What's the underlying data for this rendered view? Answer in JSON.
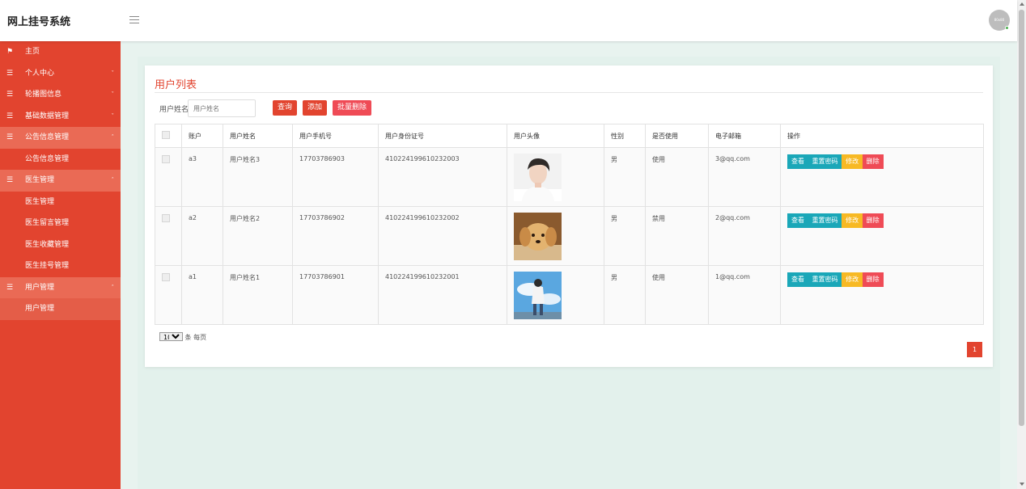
{
  "app": {
    "title": "网上挂号系统",
    "avatar_text": "80x80"
  },
  "sidebar": {
    "items": [
      {
        "label": "主页",
        "icon": "flag-icon",
        "caret": ""
      },
      {
        "label": "个人中心",
        "icon": "menu-icon",
        "caret": "ˇ"
      },
      {
        "label": "轮播图信息",
        "icon": "menu-icon",
        "caret": "ˇ"
      },
      {
        "label": "基础数据管理",
        "icon": "menu-icon",
        "caret": "ˇ"
      },
      {
        "label": "公告信息管理",
        "icon": "menu-icon",
        "caret": "ˆ"
      },
      {
        "label": "医生管理",
        "icon": "menu-icon",
        "caret": "ˆ"
      },
      {
        "label": "用户管理",
        "icon": "menu-icon",
        "caret": "ˆ"
      }
    ],
    "sub_notice": [
      "公告信息管理"
    ],
    "sub_doctor": [
      "医生管理",
      "医生留言管理",
      "医生收藏管理",
      "医生挂号管理"
    ],
    "sub_user": [
      "用户管理"
    ]
  },
  "main": {
    "title": "用户列表",
    "search": {
      "label": "用户姓名",
      "placeholder": "用户姓名",
      "value": ""
    },
    "buttons": {
      "query": "查询",
      "add": "添加",
      "batch_delete": "批量删除"
    },
    "table": {
      "headers": [
        "",
        "账户",
        "用户姓名",
        "用户手机号",
        "用户身份证号",
        "用户头像",
        "性别",
        "是否使用",
        "电子邮箱",
        "操作"
      ],
      "rows": [
        {
          "account": "a3",
          "name": "用户姓名3",
          "phone": "17703786903",
          "id_card": "410224199610232003",
          "gender": "男",
          "status": "使用",
          "email": "3@qq.com"
        },
        {
          "account": "a2",
          "name": "用户姓名2",
          "phone": "17703786902",
          "id_card": "410224199610232002",
          "gender": "男",
          "status": "禁用",
          "email": "2@qq.com"
        },
        {
          "account": "a1",
          "name": "用户姓名1",
          "phone": "17703786901",
          "id_card": "410224199610232001",
          "gender": "男",
          "status": "使用",
          "email": "1@qq.com"
        }
      ],
      "actions": {
        "view": "查看",
        "reset": "重置密码",
        "edit": "修改",
        "delete": "删除"
      }
    },
    "pagination": {
      "page_size": "10",
      "page_size_suffix": "条 每页",
      "current_page": "1"
    }
  },
  "colors": {
    "primary": "#e2442f",
    "info": "#1aa7b8",
    "warning": "#f7b924",
    "danger": "#ef4b56"
  }
}
